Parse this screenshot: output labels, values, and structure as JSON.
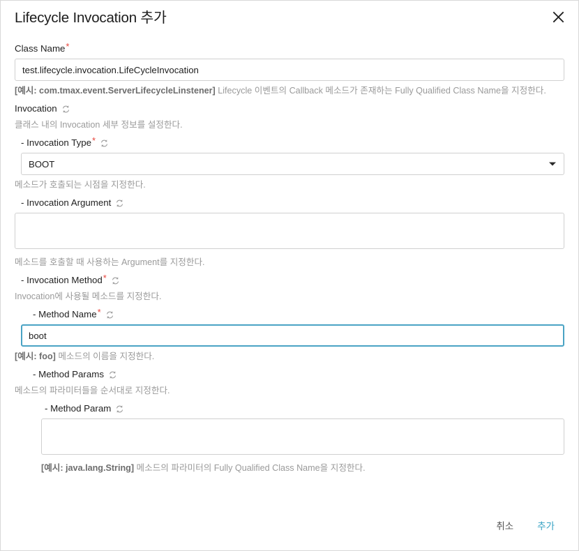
{
  "dialog": {
    "title": "Lifecycle Invocation 추가",
    "close_icon": "close-icon"
  },
  "colors": {
    "accent": "#36a2c4",
    "focus_border": "#4aa3c4",
    "required_asterisk": "#e8453c",
    "description_text": "#9a9a9a",
    "border": "#d0d0d0"
  },
  "fields": {
    "class_name": {
      "label": "Class Name",
      "required": true,
      "has_refresh": false,
      "value": "test.lifecycle.invocation.LifeCycleInvocation",
      "desc_example": "[예시: com.tmax.event.ServerLifecycleLinstener]",
      "desc_text": " Lifecycle 이벤트의 Callback 메소드가 존재하는 Fully Qualified Class Name을 지정한다."
    },
    "invocation": {
      "label": "Invocation",
      "required": false,
      "has_refresh": true,
      "desc_text": "클래스 내의 Invocation 세부 정보를 설정한다."
    },
    "invocation_type": {
      "label": "- Invocation Type",
      "required": true,
      "has_refresh": true,
      "value": "BOOT",
      "options": [
        "BOOT"
      ],
      "desc_text": "메소드가 호출되는 시점을 지정한다."
    },
    "invocation_argument": {
      "label": "- Invocation Argument",
      "required": false,
      "has_refresh": true,
      "value": "",
      "desc_text": "메소드를 호출할 때 사용하는 Argument를 지정한다."
    },
    "invocation_method": {
      "label": "- Invocation Method",
      "required": true,
      "has_refresh": true,
      "desc_text": "Invocation에 사용될 메소드를 지정한다."
    },
    "method_name": {
      "label": "- Method Name",
      "required": true,
      "has_refresh": true,
      "value": "boot",
      "focused": true,
      "desc_example": "[예시: foo]",
      "desc_text": " 메소드의 이름을 지정한다."
    },
    "method_params": {
      "label": "- Method Params",
      "required": false,
      "has_refresh": true,
      "desc_text": "메소드의 파라미터들을 순서대로 지정한다."
    },
    "method_param": {
      "label": "- Method Param",
      "required": false,
      "has_refresh": true,
      "value": "",
      "desc_example": "[예시: java.lang.String]",
      "desc_text": " 메소드의 파라미터의 Fully Qualified Class Name을 지정한다."
    }
  },
  "footer": {
    "cancel_label": "취소",
    "submit_label": "추가"
  }
}
